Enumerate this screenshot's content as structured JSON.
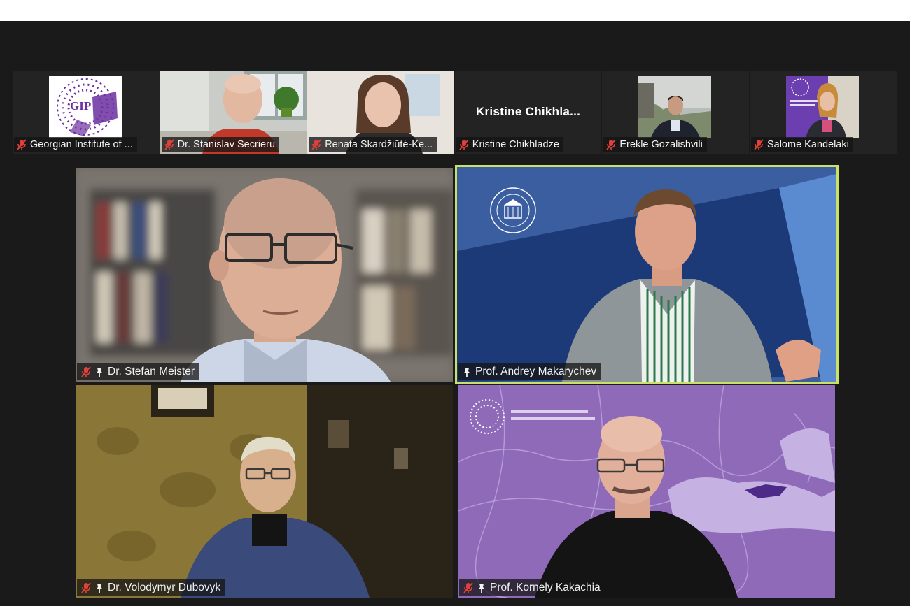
{
  "window": {
    "title": ""
  },
  "accent_colors": {
    "active_speaker_border": "#c9e265",
    "mute_icon": "#e0403a",
    "tag_bg": "#141414"
  },
  "thumbnails": [
    {
      "name": "Georgian Institute of ...",
      "muted": true,
      "logo_text": "GIP"
    },
    {
      "name": "Dr. Stanislav Secrieru",
      "muted": true
    },
    {
      "name": "Renata Skardžiūtė-Ke...",
      "muted": true
    },
    {
      "name": "Kristine Chikhladze",
      "muted": true,
      "display_name": "Kristine  Chikhla..."
    },
    {
      "name": "Erekle Gozalishvili",
      "muted": true
    },
    {
      "name": "Salome Kandelaki",
      "muted": true
    }
  ],
  "tiles": [
    {
      "name": "Dr. Stefan Meister",
      "muted": true,
      "pinned": true,
      "active": false
    },
    {
      "name": "Prof. Andrey Makarychev",
      "muted": false,
      "pinned": true,
      "active": true
    },
    {
      "name": "Dr. Volodymyr Dubovyk",
      "muted": true,
      "pinned": true,
      "active": false
    },
    {
      "name": "Prof. Kornely Kakachia",
      "muted": true,
      "pinned": true,
      "active": false
    }
  ],
  "icons": [
    "mic-muted-icon",
    "pin-icon"
  ]
}
